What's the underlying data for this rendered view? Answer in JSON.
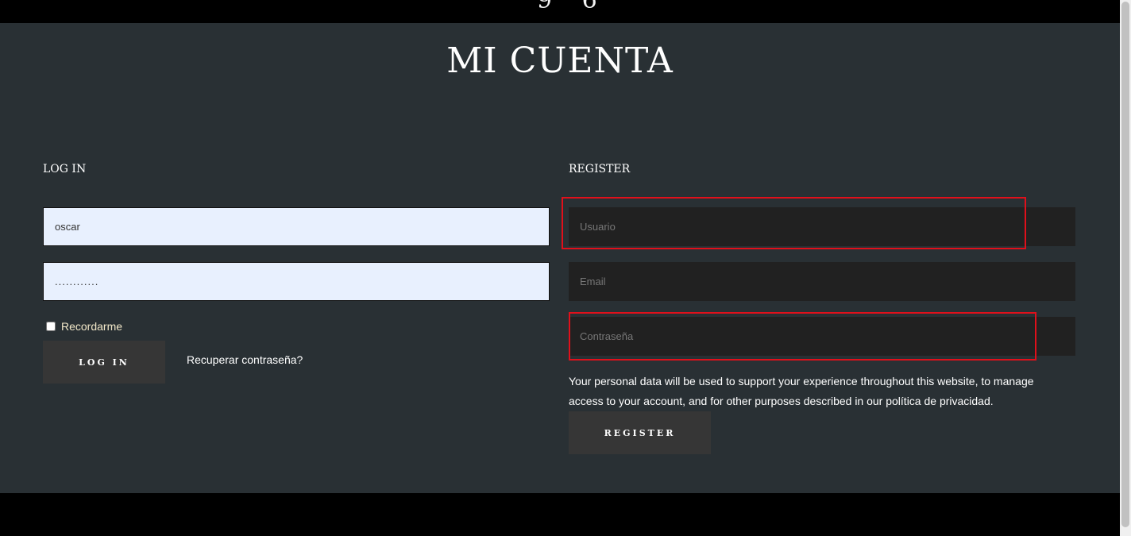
{
  "header": {
    "logo_fragment": "9 6"
  },
  "page": {
    "title": "MI CUENTA"
  },
  "login": {
    "heading": "LOG IN",
    "username_value": "oscar",
    "password_value": "............",
    "remember_label": "Recordarme",
    "submit_label": "LOG IN",
    "lost_password_label": "Recuperar contraseña?"
  },
  "register": {
    "heading": "REGISTER",
    "username_placeholder": "Usuario",
    "email_placeholder": "Email",
    "password_placeholder": "Contraseña",
    "privacy_text_before": "Your personal data will be used to support your experience throughout this website, to manage access to your account, and for other purposes described in our ",
    "privacy_link_label": "política de privacidad",
    "privacy_text_after": ".",
    "submit_label": "REGISTER"
  },
  "colors": {
    "main_background": "#293034",
    "field_dark": "#212121",
    "field_autofill": "#e8f0fe",
    "button": "#363636",
    "highlight": "#e0101b"
  }
}
